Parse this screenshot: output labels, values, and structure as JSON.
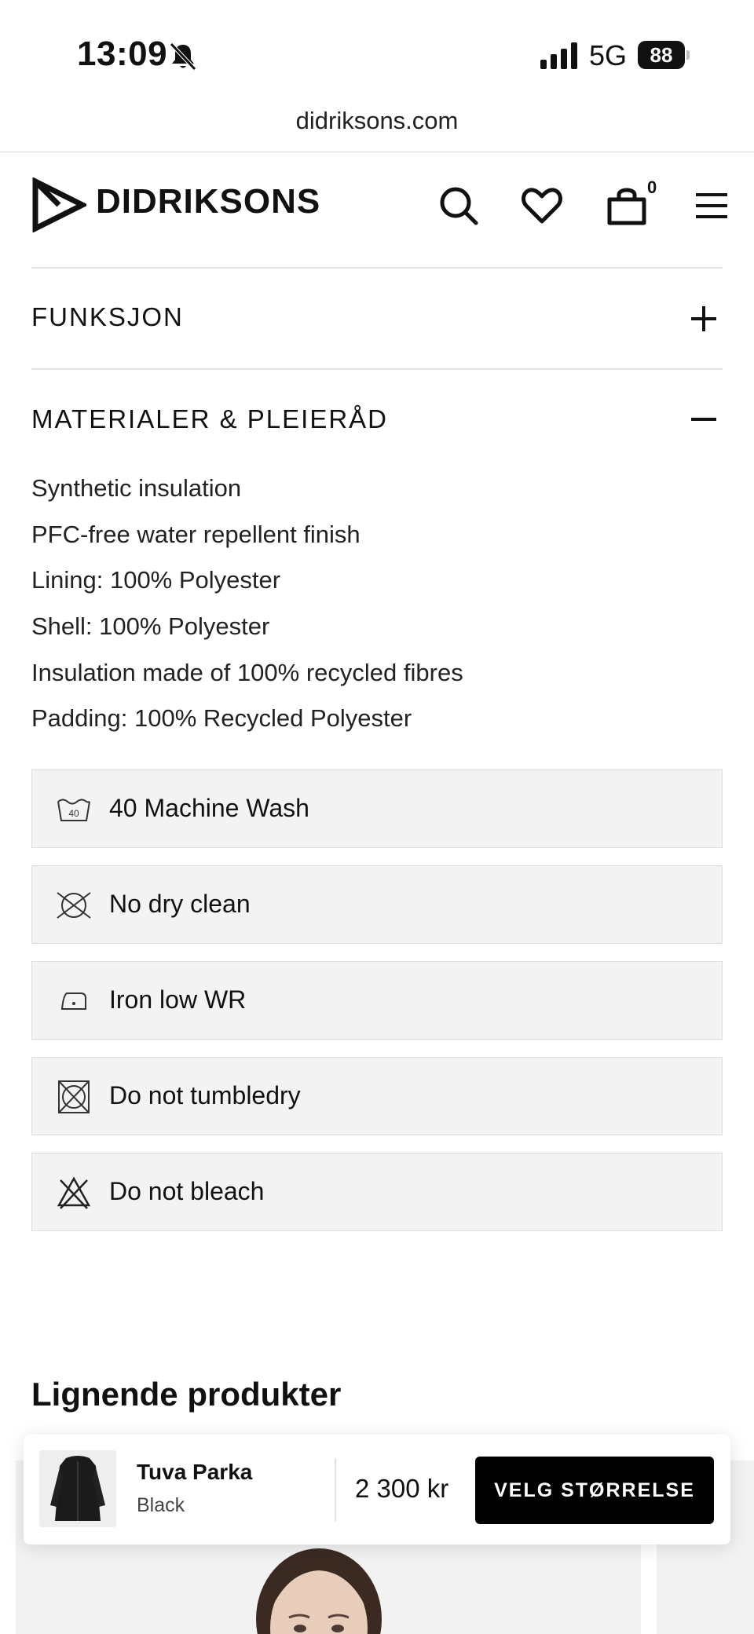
{
  "status_bar": {
    "time": "13:09",
    "network": "5G",
    "battery": "88"
  },
  "browser": {
    "url": "didriksons.com"
  },
  "header": {
    "brand": "DIDRIKSONS",
    "cart_count": "0"
  },
  "accordion": {
    "function_title": "FUNKSJON",
    "materials_title": "MATERIALER & PLEIERÅD",
    "materials": [
      "Synthetic insulation",
      "PFC-free water repellent finish",
      "Lining: 100% Polyester",
      "Shell: 100% Polyester",
      "Insulation made of 100% recycled fibres",
      "Padding: 100% Recycled Polyester"
    ],
    "care": [
      {
        "icon": "wash-40-icon",
        "label": "40 Machine Wash",
        "wash_temp": "40"
      },
      {
        "icon": "no-dry-clean-icon",
        "label": "No dry clean"
      },
      {
        "icon": "iron-low-icon",
        "label": "Iron low WR"
      },
      {
        "icon": "no-tumble-dry-icon",
        "label": "Do not tumbledry"
      },
      {
        "icon": "no-bleach-icon",
        "label": "Do not bleach"
      }
    ]
  },
  "similar": {
    "heading": "Lignende produkter"
  },
  "sticky_bar": {
    "product_name": "Tuva Parka",
    "color": "Black",
    "price": "2 300 kr",
    "cta": "VELG STØRRELSE"
  }
}
